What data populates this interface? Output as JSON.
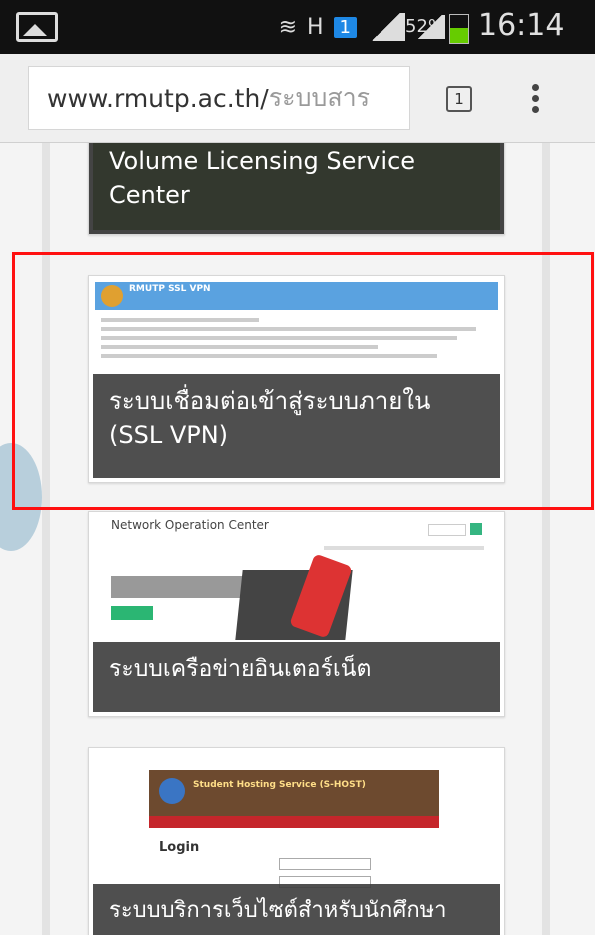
{
  "status_bar": {
    "battery_percent": "52%",
    "battery_level": 0.52,
    "time": "16:14",
    "sim_badge": "1",
    "hsdpa_label": "H",
    "icons": [
      "image-icon",
      "vibrate-mute-icon",
      "network-h-icon",
      "sim-1-icon",
      "signal-icon",
      "signal-2-icon",
      "battery-icon"
    ]
  },
  "browser": {
    "url_host": "www.rmutp.ac.th/",
    "url_path": "ระบบสาร",
    "tabs_count": "1"
  },
  "cards": [
    {
      "caption": "Volume Licensing Service Center",
      "thumbnail": "dark-web-page-thumbnail"
    },
    {
      "caption": "ระบบเชื่อมต่อเข้าสู่ระบบภายใน (SSL VPN)",
      "thumbnail": "ssl-vpn-login-page-thumbnail",
      "thumb_text": {
        "header": "RMUTP SSL VPN"
      }
    },
    {
      "caption": "ระบบเครือข่ายอินเตอร์เน็ต",
      "thumbnail": "network-operation-center-thumbnail",
      "thumb_text": {
        "header": "Network Operation Center"
      }
    },
    {
      "caption": "ระบบบริการเว็บไซต์สำหรับนักศึกษา",
      "thumbnail": "student-hosting-service-thumbnail",
      "thumb_text": {
        "header": "Student Hosting Service (S-HOST)",
        "login": "Login"
      }
    }
  ],
  "colors": {
    "highlight_border": "#ff1010",
    "caption_bg": "#3c3c3c",
    "status_bar_bg": "#111111",
    "url_bar_bg": "#efefef"
  }
}
